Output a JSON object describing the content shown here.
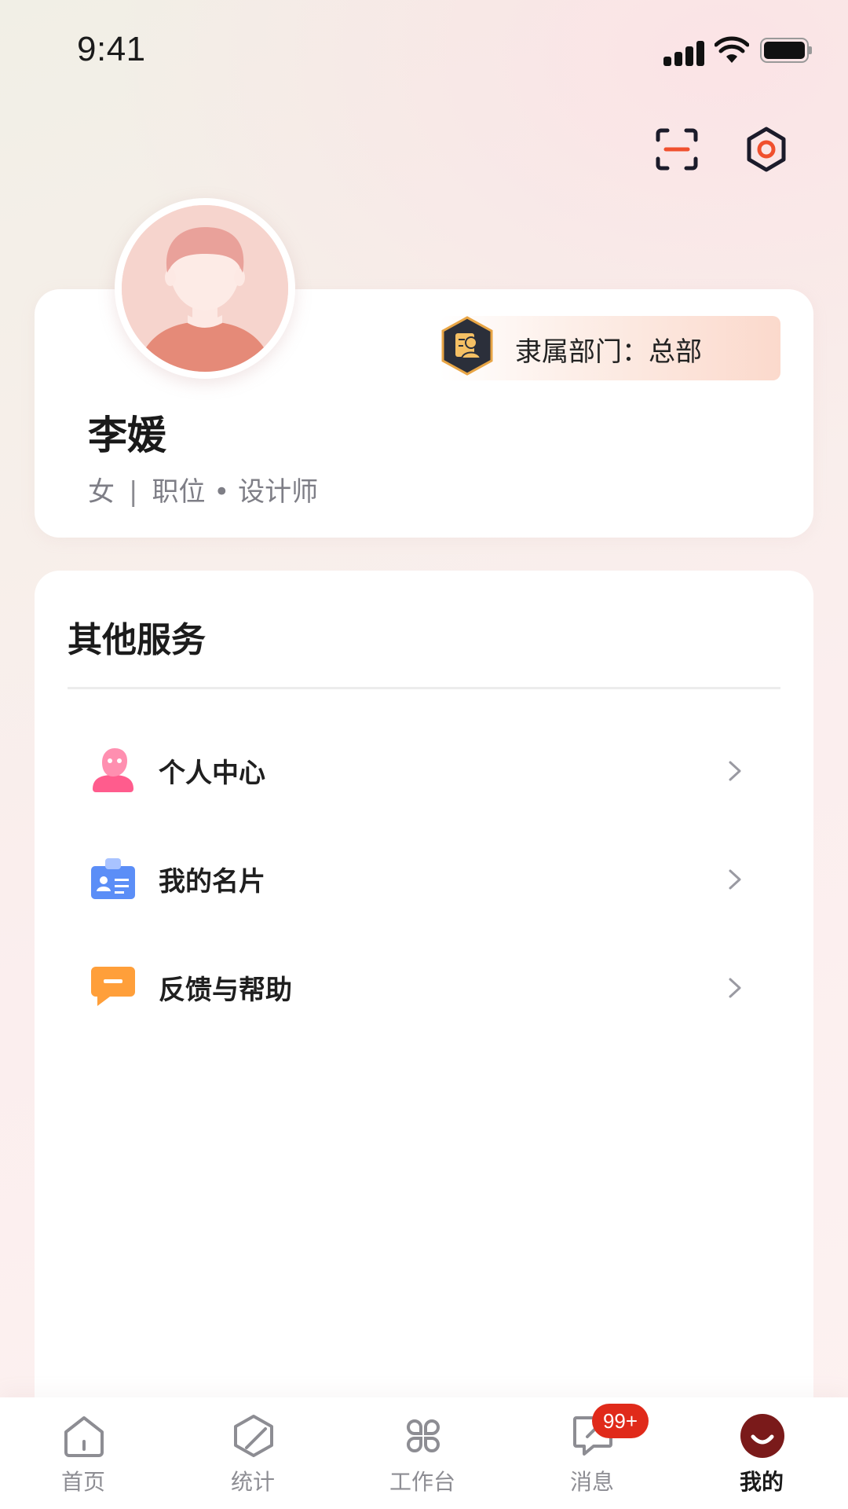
{
  "status_bar": {
    "time": "9:41"
  },
  "header": {
    "scan_icon": "scan-icon",
    "settings_icon": "settings-icon"
  },
  "profile": {
    "name": "李媛",
    "gender": "女",
    "separator": "|",
    "position": "职位 • 设计师",
    "department_label": "隶属部门：总部",
    "department_icon": "department-badge-icon"
  },
  "services": {
    "title": "其他服务",
    "items": [
      {
        "label": "个人中心",
        "icon": "person-icon",
        "color": "#ff5c8d"
      },
      {
        "label": "我的名片",
        "icon": "business-card-icon",
        "color": "#5b8ef7"
      },
      {
        "label": "反馈与帮助",
        "icon": "feedback-icon",
        "color": "#ff9f3a"
      }
    ]
  },
  "tabbar": {
    "tabs": [
      {
        "label": "首页",
        "icon": "home-icon"
      },
      {
        "label": "统计",
        "icon": "stats-cube-icon"
      },
      {
        "label": "工作台",
        "icon": "workbench-icon"
      },
      {
        "label": "消息",
        "icon": "message-icon",
        "badge": "99+"
      },
      {
        "label": "我的",
        "icon": "me-smile-icon",
        "active": true
      }
    ]
  },
  "colors": {
    "accent": "#7a1a1a",
    "badge": "#e02a1a",
    "scan_accent": "#f0502e"
  }
}
